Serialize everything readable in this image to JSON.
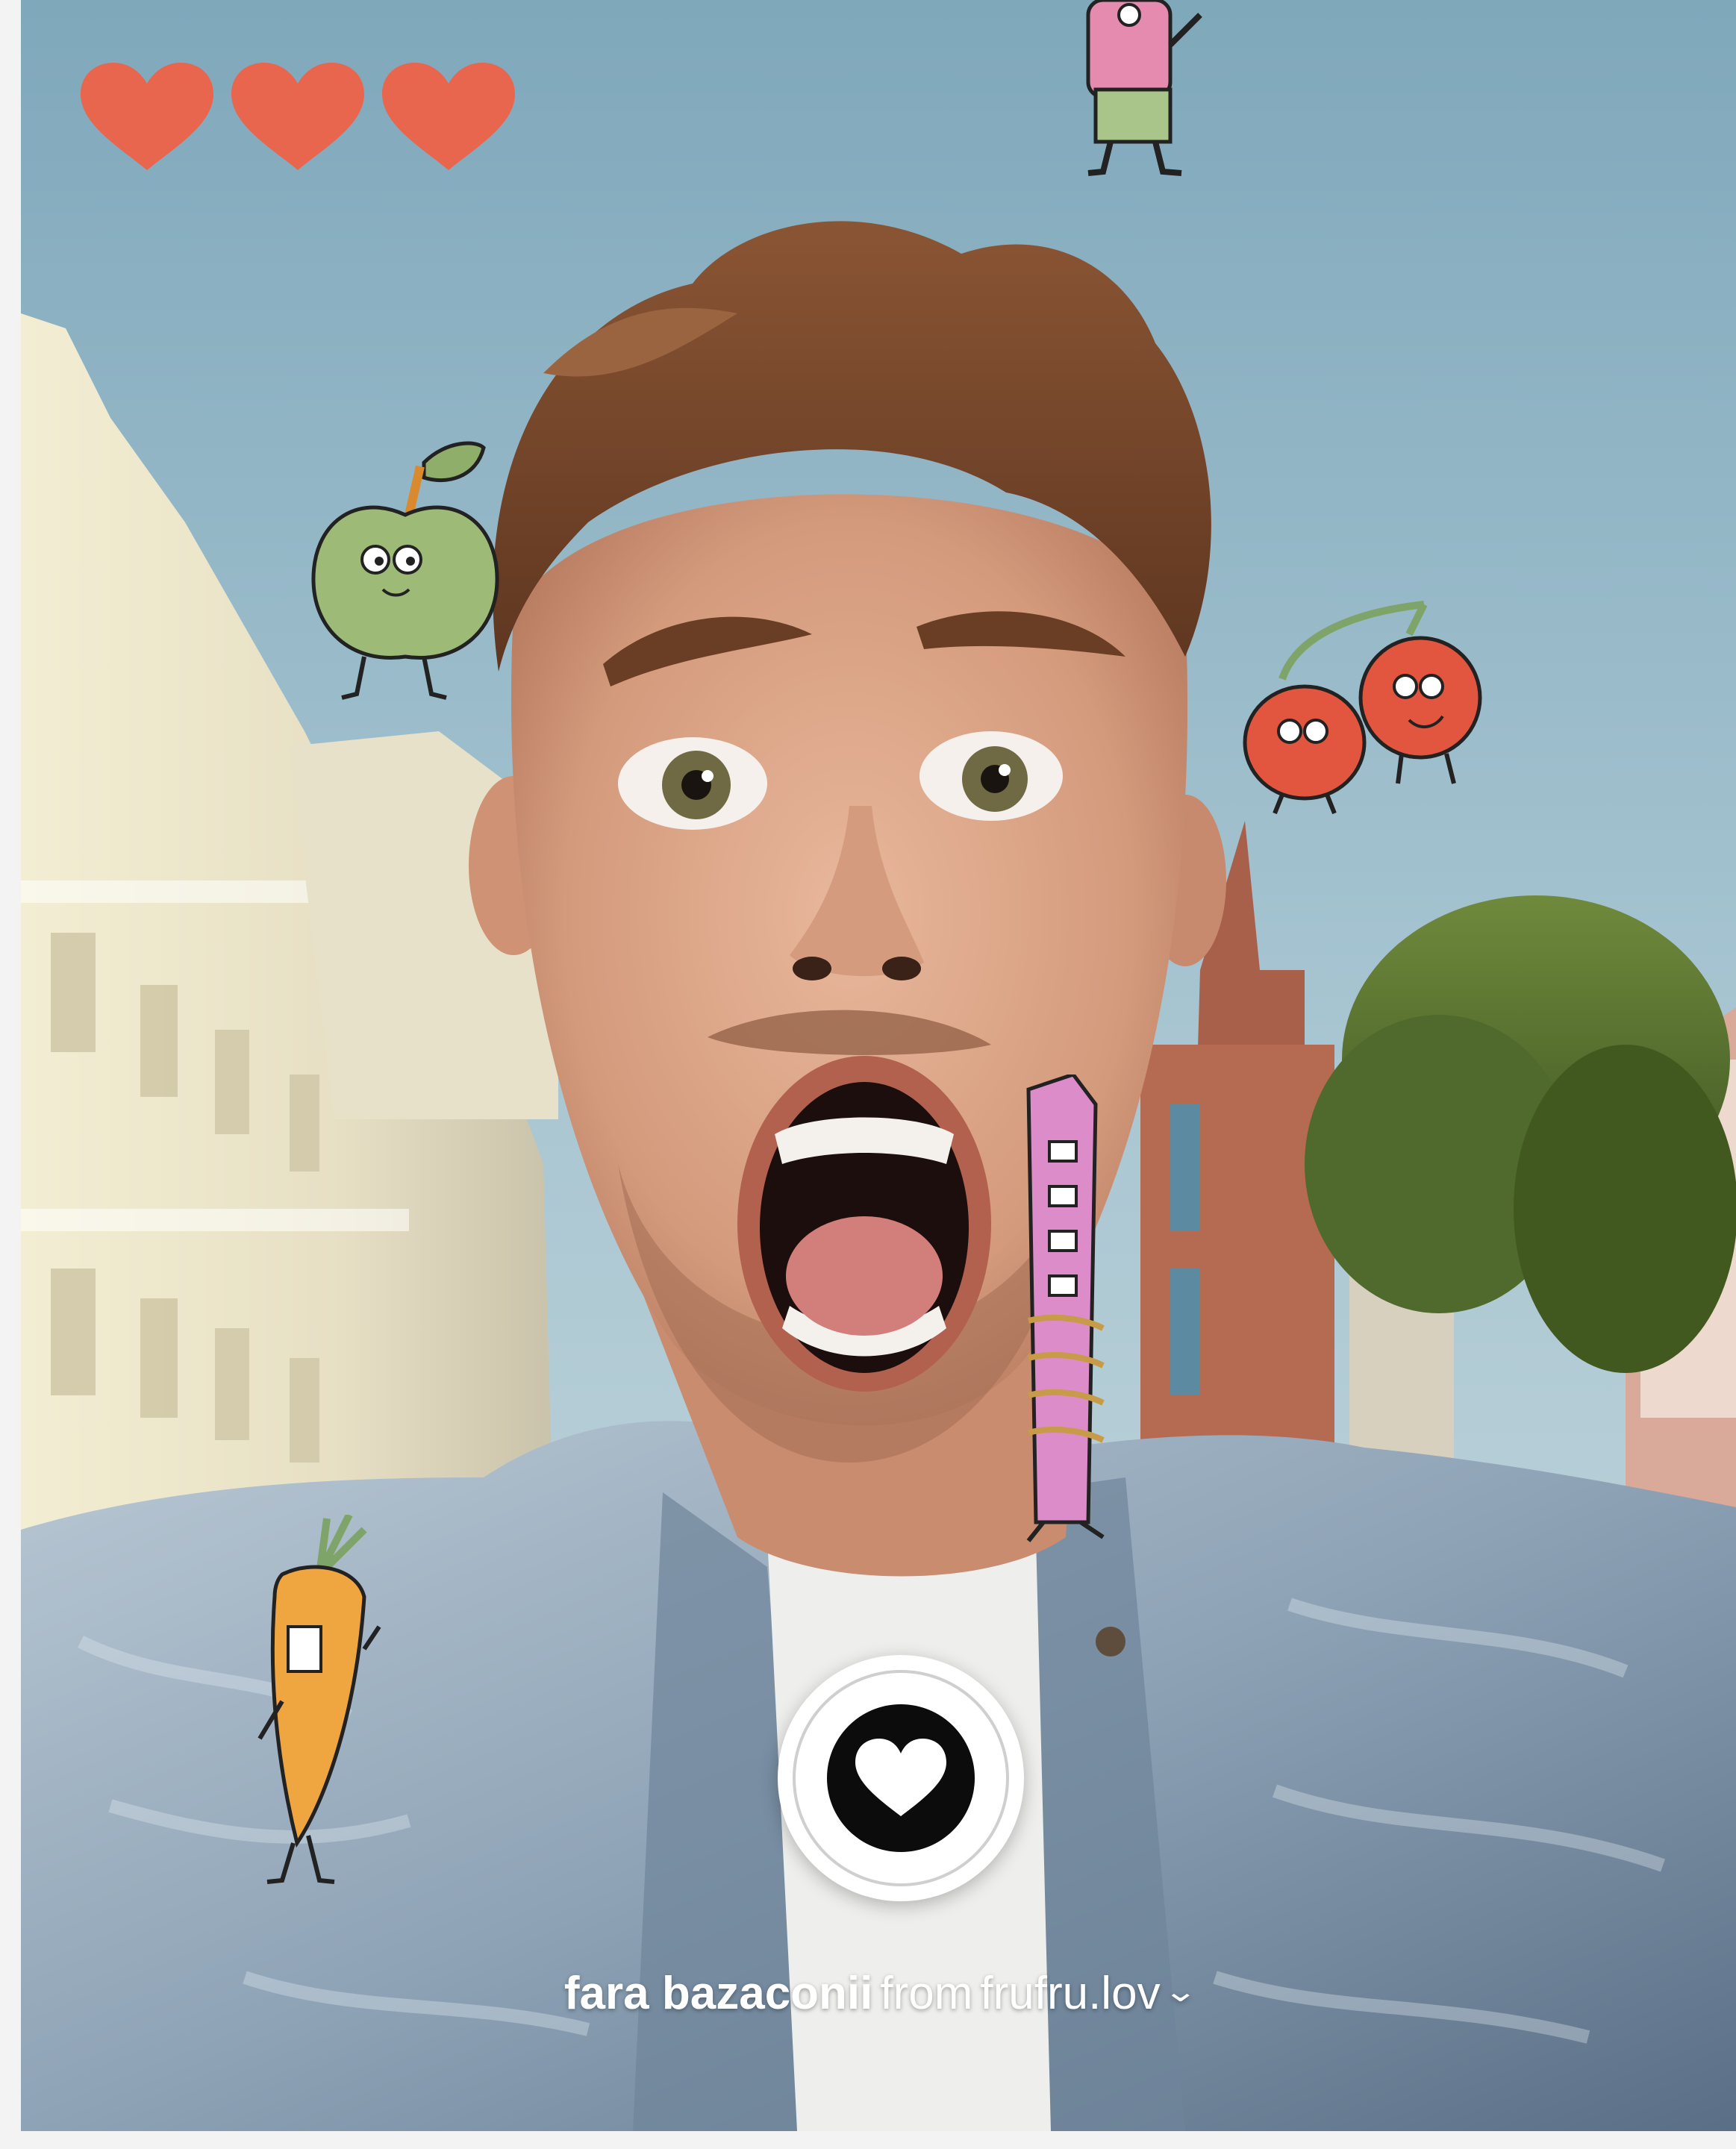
{
  "caption": {
    "username": "fara bazaconii",
    "from_word": "from",
    "source_account": "frufru.lov",
    "chevron": "⌄"
  },
  "lives": {
    "count": 3,
    "color": "#e8664e",
    "icon": "heart-icon"
  },
  "like_button": {
    "icon": "heart-icon",
    "ring_color": "#ffffff",
    "inner_color": "#0c0c0c"
  },
  "stickers": [
    "creature-icon",
    "apple-icon",
    "tomatoes-icon",
    "tower-creature-icon",
    "carrot-icon"
  ]
}
